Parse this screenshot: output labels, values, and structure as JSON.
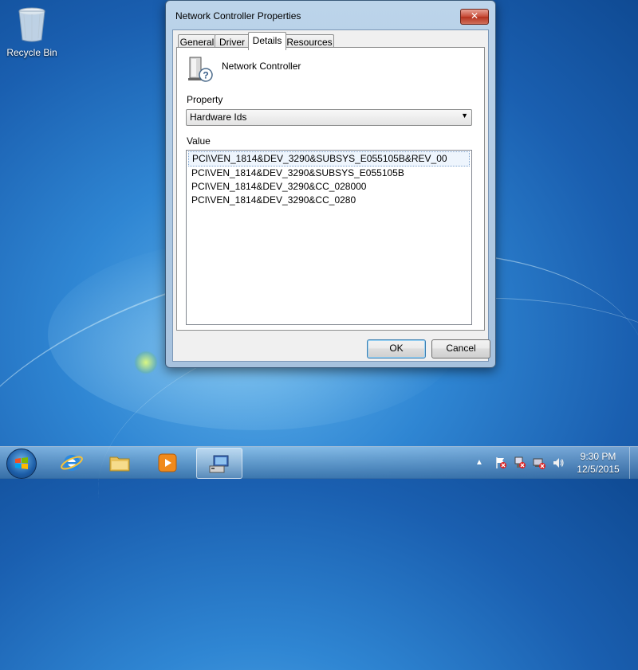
{
  "desktop": {
    "recycle_bin_label": "Recycle Bin"
  },
  "dialog": {
    "title": "Network Controller Properties",
    "close_symbol": "✕",
    "tabs": [
      {
        "label": "General",
        "active": false
      },
      {
        "label": "Driver",
        "active": false
      },
      {
        "label": "Details",
        "active": true
      },
      {
        "label": "Resources",
        "active": false
      }
    ],
    "device_name": "Network Controller",
    "property_label": "Property",
    "property_selected": "Hardware Ids",
    "value_label": "Value",
    "values": [
      "PCI\\VEN_1814&DEV_3290&SUBSYS_E055105B&REV_00",
      "PCI\\VEN_1814&DEV_3290&SUBSYS_E055105B",
      "PCI\\VEN_1814&DEV_3290&CC_028000",
      "PCI\\VEN_1814&DEV_3290&CC_0280"
    ],
    "ok_label": "OK",
    "cancel_label": "Cancel"
  },
  "taskbar": {
    "pinned": [
      "internet-explorer-icon",
      "folder-icon",
      "media-player-icon",
      "device-manager-icon"
    ],
    "tray_icons": [
      "show-hidden-icons-arrow",
      "action-center-icon",
      "network-icon",
      "network-error-icon",
      "volume-icon"
    ],
    "time": "9:30 PM",
    "date": "12/5/2015"
  },
  "colors": {
    "close_button": "#c74a36",
    "ok_border": "#3c7fb1",
    "desktop": "#2f86d3"
  }
}
